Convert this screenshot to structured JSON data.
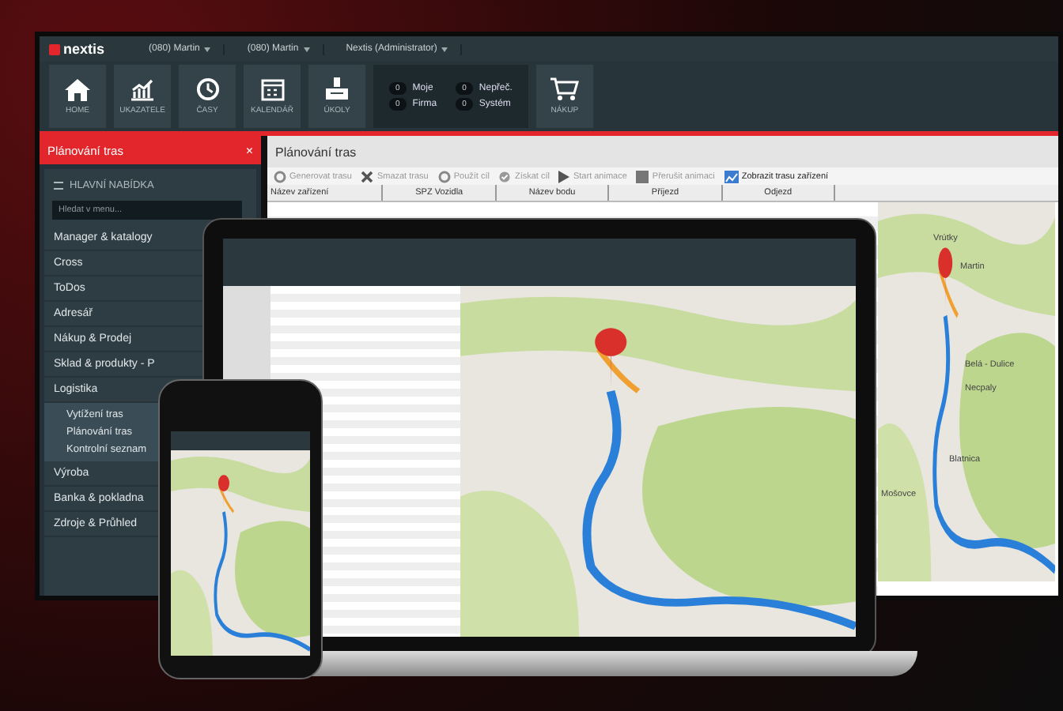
{
  "app": {
    "logo": "nextis",
    "user_menus": [
      "(080) Martin",
      "(080) Martin",
      "Nextis (Administrator)"
    ],
    "tiles": [
      {
        "kind": "home",
        "label": "HOME"
      },
      {
        "kind": "chart",
        "label": "UKAZATELE"
      },
      {
        "kind": "clock",
        "label": "ČASY"
      },
      {
        "kind": "calendar",
        "label": "KALENDÁŘ"
      },
      {
        "kind": "printer",
        "label": "ÚKOLY"
      }
    ],
    "counters": [
      {
        "count": "0",
        "label": "Moje"
      },
      {
        "count": "0",
        "label": "Nepřeč."
      },
      {
        "count": "0",
        "label": "Firma"
      },
      {
        "count": "0",
        "label": "Systém"
      }
    ],
    "cart": {
      "label": "NÁKUP"
    }
  },
  "sidebar": {
    "active_tab": "Plánování tras",
    "close": "×",
    "heading": "HLAVNÍ NABÍDKA",
    "search_placeholder": "Hledat v menu...",
    "items": [
      {
        "label": "Manager & katalogy"
      },
      {
        "label": "Cross"
      },
      {
        "label": "ToDos"
      },
      {
        "label": "Adresář"
      },
      {
        "label": "Nákup & Prodej"
      },
      {
        "label": "Sklad & produkty - P"
      },
      {
        "label": "Logistika",
        "children": [
          {
            "label": "Vytížení tras"
          },
          {
            "label": "Plánování tras"
          },
          {
            "label": "Kontrolní seznam"
          }
        ]
      },
      {
        "label": "Výroba"
      },
      {
        "label": "Banka & pokladna"
      },
      {
        "label": "Zdroje & Průhled"
      }
    ]
  },
  "main": {
    "title": "Plánování tras",
    "toolbar": [
      {
        "kind": "gear",
        "label": "Generovat trasu",
        "disabled": true
      },
      {
        "kind": "cross",
        "label": "Smazat trasu",
        "disabled": true
      },
      {
        "kind": "gear",
        "label": "Použít cíl",
        "disabled": true
      },
      {
        "kind": "check",
        "label": "Získat cíl",
        "disabled": true
      },
      {
        "kind": "play",
        "label": "Start animace",
        "disabled": true
      },
      {
        "kind": "stop",
        "label": "Přerušit animaci",
        "disabled": true
      },
      {
        "kind": "chart",
        "label": "Zobrazit trasu zařízení",
        "disabled": false
      }
    ],
    "columns": [
      "Název zařízení",
      "SPZ Vozidla",
      "Název bodu",
      "Příjezd",
      "Odjezd"
    ],
    "map_labels": [
      "Vrútky",
      "Martin",
      "Belá - Dulice",
      "Necpaly",
      "Blatnica",
      "Mošovce"
    ]
  }
}
